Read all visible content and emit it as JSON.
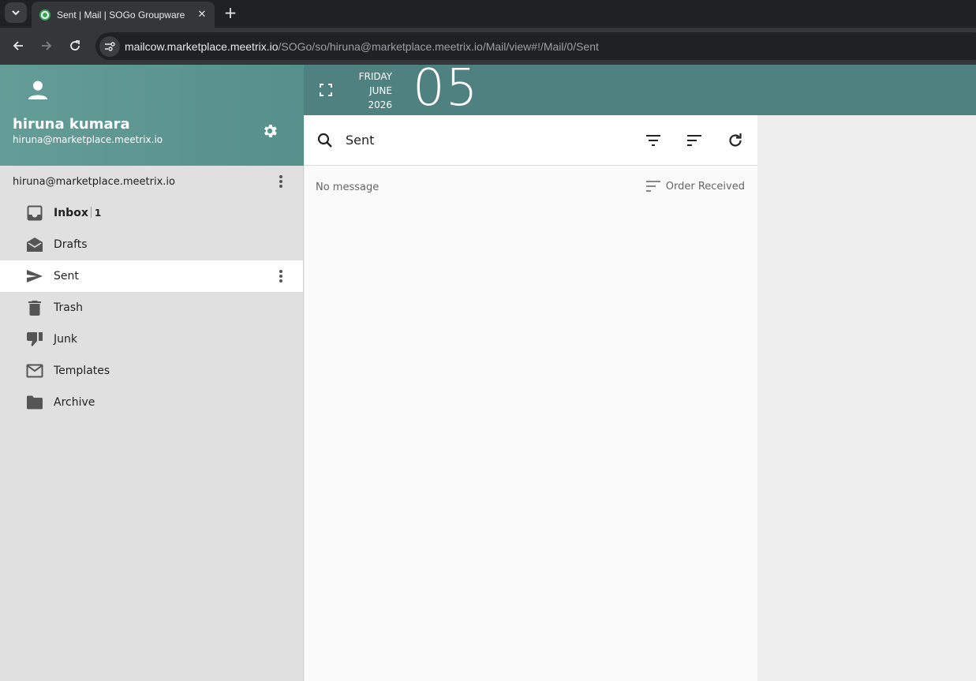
{
  "browser": {
    "tab_title": "Sent | Mail | SOGo Groupware",
    "close_glyph": "✕",
    "new_tab_glyph": "+",
    "url_host": "mailcow.marketplace.meetrix.io",
    "url_path": "/SOGo/so/hiruna@marketplace.meetrix.io/Mail/view#!/Mail/0/Sent"
  },
  "user": {
    "name": "hiruna kumara",
    "email": "hiruna@marketplace.meetrix.io"
  },
  "account": {
    "label": "hiruna@marketplace.meetrix.io"
  },
  "folders": [
    {
      "label": "Inbox",
      "icon": "inbox-icon",
      "unread": "1",
      "bold": true
    },
    {
      "label": "Drafts",
      "icon": "drafts-icon"
    },
    {
      "label": "Sent",
      "icon": "send-icon",
      "active": true
    },
    {
      "label": "Trash",
      "icon": "trash-icon"
    },
    {
      "label": "Junk",
      "icon": "thumb-down-icon"
    },
    {
      "label": "Templates",
      "icon": "mail-icon"
    },
    {
      "label": "Archive",
      "icon": "folder-icon"
    }
  ],
  "date": {
    "weekday": "FRIDAY",
    "month": "JUNE",
    "year": "2026",
    "day": "05"
  },
  "list": {
    "title": "Sent",
    "status": "No message",
    "sort_label": "Order Received"
  },
  "colors": {
    "header_teal": "#5b9590",
    "date_bar_teal": "#4e817f",
    "sidebar_bg": "#e0e0e0"
  }
}
